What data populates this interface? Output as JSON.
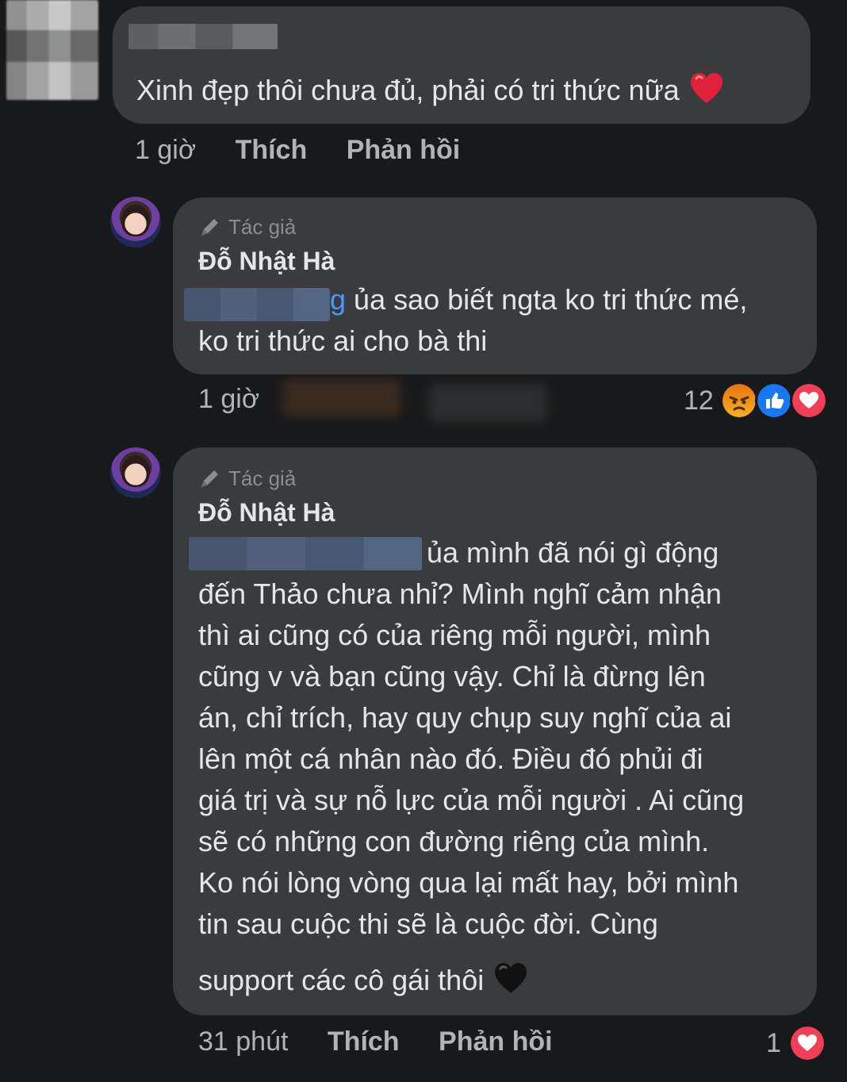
{
  "comment": {
    "text": "Xinh đẹp thôi chưa đủ, phải có tri thức nữa",
    "time": "1 giờ",
    "like_label": "Thích",
    "reply_label": "Phản hồi"
  },
  "replies": [
    {
      "author_tag": "Tác giả",
      "author_name": "Đỗ Nhật Hà",
      "mention_tail": "g",
      "lines": [
        "ủa sao biết ngta ko tri thức mé,",
        "ko tri thức ai cho bà thi"
      ],
      "time": "1 giờ",
      "reaction_count": "12",
      "reactions": [
        "angry-icon",
        "like-icon",
        "love-icon"
      ]
    },
    {
      "author_tag": "Tác giả",
      "author_name": "Đỗ Nhật Hà",
      "lines": [
        "ủa mình đã nói gì động",
        "đến Thảo chưa nhỉ? Mình nghĩ cảm nhận",
        "thì ai cũng có của riêng mỗi người, mình",
        "cũng v và bạn cũng vậy. Chỉ là đừng lên",
        "án, chỉ trích, hay quy chụp suy nghĩ của ai",
        "lên một cá nhân nào đó. Điều đó phủi đi",
        "giá trị và sự nỗ lực của mỗi người . Ai cũng",
        "sẽ có những con đường riêng của mình.",
        "Ko nói lòng vòng qua lại mất hay, bởi mình",
        "tin sau cuộc thi sẽ là cuộc đời. Cùng",
        "support các cô gái thôi"
      ],
      "time": "31 phút",
      "like_label": "Thích",
      "reply_label": "Phản hồi",
      "reaction_count": "1",
      "reactions": [
        "love-icon"
      ]
    }
  ],
  "colors": {
    "background": "#18191a",
    "bubble": "#3a3b3c",
    "text": "#e4e6eb",
    "meta": "#b0b3b8",
    "mention": "#4599ff",
    "heart": "#f33e58",
    "like": "#1877f2",
    "angry": "#e9710f"
  }
}
